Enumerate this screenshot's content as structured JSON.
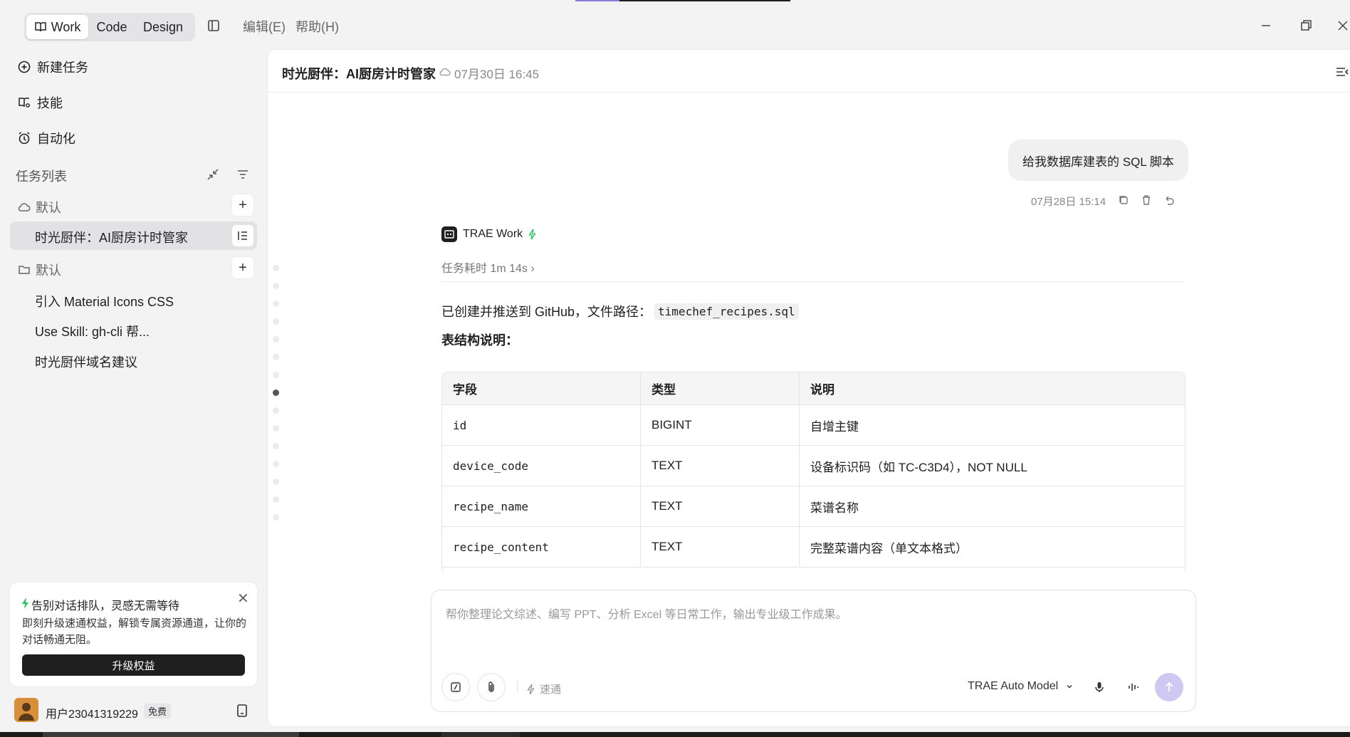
{
  "titlebar": {
    "modes": [
      "Work",
      "Code",
      "Design"
    ],
    "menu": [
      "编辑(E)",
      "帮助(H)"
    ]
  },
  "sidebar": {
    "nav": [
      "新建任务",
      "技能",
      "自动化"
    ],
    "section_title": "任务列表",
    "group1": "默认",
    "active_task": "时光厨伴：AI厨房计时管家",
    "group2": "默认",
    "tasks": [
      "引入 Material Icons CSS",
      "Use Skill: gh-cli 帮...",
      "时光厨伴域名建议"
    ],
    "promo": {
      "title": "告别对话排队，灵感无需等待",
      "desc": "即刻升级速通权益，解锁专属资源通道，让你的对话畅通无阻。",
      "button": "升级权益"
    },
    "user": {
      "name": "用户23041319229",
      "badge": "免费"
    }
  },
  "main": {
    "title": "时光厨伴：AI厨房计时管家",
    "time": "07月30日 16:45",
    "user_message": "给我数据库建表的 SQL 脚本",
    "message_time": "07月28日 15:14",
    "agent_name": "TRAE Work",
    "task_time": "任务耗时 1m 14s",
    "result_prefix": "已创建并推送到 GitHub，文件路径：",
    "result_file": "timechef_recipes.sql",
    "struct_title": "表结构说明：",
    "table": {
      "headers": [
        "字段",
        "类型",
        "说明"
      ],
      "rows": [
        [
          "id",
          "BIGINT",
          "自增主键"
        ],
        [
          "device_code",
          "TEXT",
          "设备标识码（如 TC-C3D4），NOT NULL"
        ],
        [
          "recipe_name",
          "TEXT",
          "菜谱名称"
        ],
        [
          "recipe_content",
          "TEXT",
          "完整菜谱内容（单文本格式）"
        ]
      ]
    },
    "input": {
      "placeholder": "帮你整理论文综述、编写 PPT、分析 Excel 等日常工作，输出专业级工作成果。",
      "speed_label": "速通",
      "model": "TRAE Auto Model"
    }
  },
  "colors": {
    "accent": "#1f1f1f",
    "promo_bolt": "#22c55e",
    "send": "#cfc8f3"
  }
}
